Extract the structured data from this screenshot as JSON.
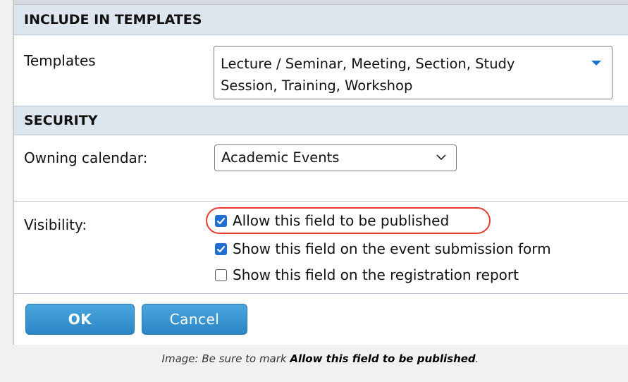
{
  "include_templates": {
    "header": "INCLUDE IN TEMPLATES",
    "templates_label": "Templates",
    "templates_value_line1": "Lecture / Seminar, Meeting, Section, Study",
    "templates_value_line2": "Session, Training, Workshop"
  },
  "security": {
    "header": "SECURITY",
    "owning_calendar_label": "Owning calendar:",
    "owning_calendar_value": "Academic Events",
    "visibility_label": "Visibility:",
    "checkboxes": [
      {
        "label": "Allow this field to be published",
        "checked": true
      },
      {
        "label": "Show this field on the event submission form",
        "checked": true
      },
      {
        "label": "Show this field on the registration report",
        "checked": false
      }
    ]
  },
  "buttons": {
    "ok_label": "OK",
    "cancel_label": "Cancel"
  },
  "caption": {
    "prefix": "Image: Be sure to mark ",
    "emphasis": "Allow this field to be published",
    "suffix": "."
  },
  "colors": {
    "header_bg": "#dde6ef",
    "accent_blue": "#1f6fd1",
    "button_blue": "#3a97d3",
    "highlight_red": "#e53c2e"
  },
  "icons": {
    "templates_dropdown": "caret-down-icon",
    "owning_dropdown": "chevron-down-icon",
    "checkbox_check": "check-icon"
  }
}
